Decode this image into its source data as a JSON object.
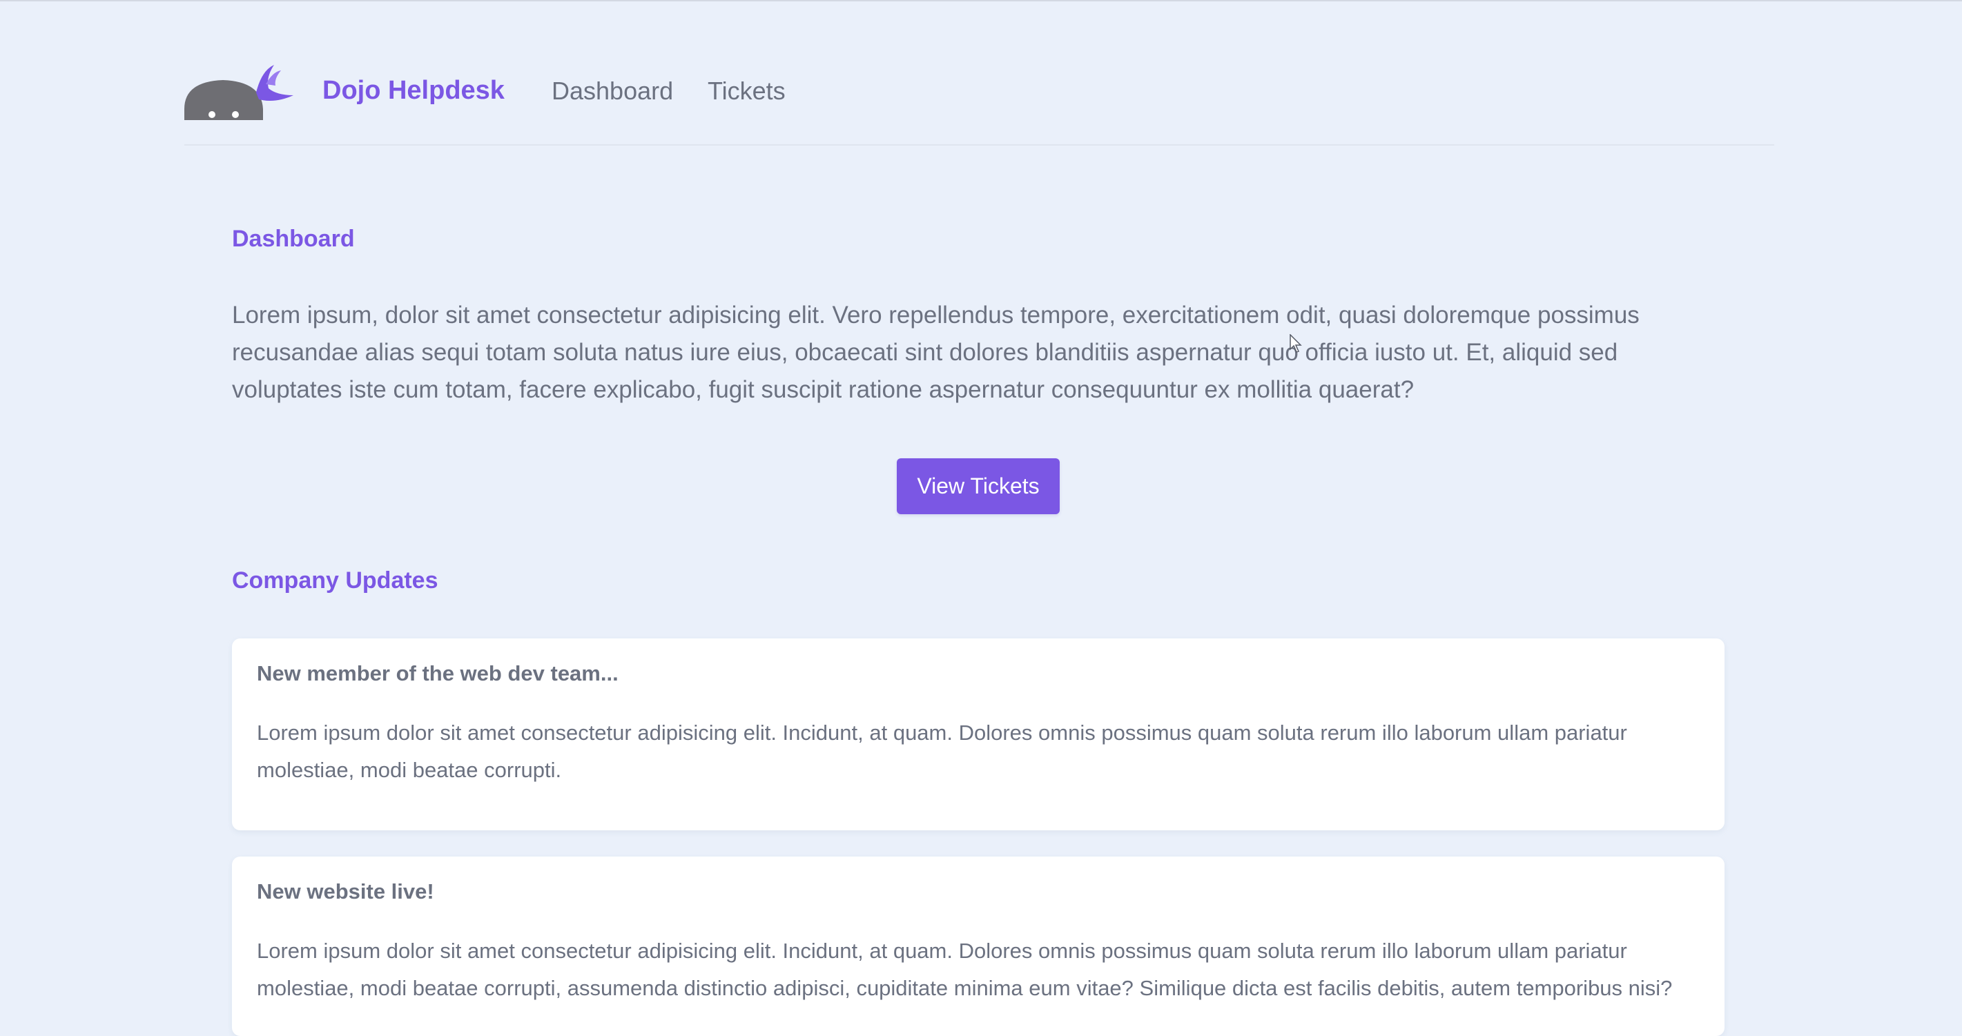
{
  "nav": {
    "brand": "Dojo Helpdesk",
    "links": [
      "Dashboard",
      "Tickets"
    ],
    "logo_icon": "ninja-logo-icon"
  },
  "dashboard": {
    "title": "Dashboard",
    "intro": "Lorem ipsum, dolor sit amet consectetur adipisicing elit. Vero repellendus tempore, exercitationem odit, quasi doloremque possimus recusandae alias sequi totam soluta natus iure eius, obcaecati sint dolores blanditiis aspernatur quo officia iusto ut. Et, aliquid sed voluptates iste cum totam, facere explicabo, fugit suscipit ratione aspernatur consequuntur ex mollitia quaerat?",
    "button_label": "View Tickets"
  },
  "updates": {
    "title": "Company Updates",
    "items": [
      {
        "title": "New member of the web dev team...",
        "body": "Lorem ipsum dolor sit amet consectetur adipisicing elit. Incidunt, at quam. Dolores omnis possimus quam soluta rerum illo laborum ullam pariatur molestiae, modi beatae corrupti."
      },
      {
        "title": "New website live!",
        "body": "Lorem ipsum dolor sit amet consectetur adipisicing elit. Incidunt, at quam. Dolores omnis possimus quam soluta rerum illo laborum ullam pariatur molestiae, modi beatae corrupti, assumenda distinctio adipisci, cupiditate minima eum vitae? Similique dicta est facilis debitis, autem temporibus nisi?"
      }
    ]
  },
  "colors": {
    "accent": "#7b57e4",
    "background": "#eaf0fa",
    "text": "#6b7180",
    "card": "#ffffff"
  }
}
